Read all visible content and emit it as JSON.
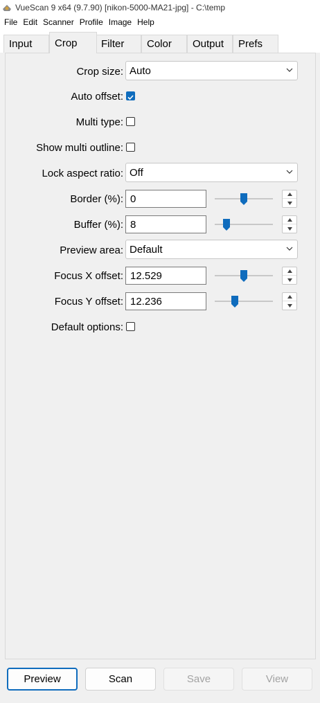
{
  "window": {
    "title": "VueScan 9 x64 (9.7.90) [nikon-5000-MA21-jpg] - C:\\temp"
  },
  "menu": {
    "items": [
      "File",
      "Edit",
      "Scanner",
      "Profile",
      "Image",
      "Help"
    ]
  },
  "tabs": [
    "Input",
    "Crop",
    "Filter",
    "Color",
    "Output",
    "Prefs"
  ],
  "active_tab": "Crop",
  "crop": {
    "crop_size": {
      "label": "Crop size:",
      "value": "Auto"
    },
    "auto_offset": {
      "label": "Auto offset:",
      "checked": true
    },
    "multi_type": {
      "label": "Multi type:",
      "checked": false
    },
    "show_multi_outline": {
      "label": "Show multi outline:",
      "checked": false
    },
    "lock_aspect_ratio": {
      "label": "Lock aspect ratio:",
      "value": "Off"
    },
    "border": {
      "label": "Border (%):",
      "value": "0",
      "slider_level": 0.5
    },
    "buffer": {
      "label": "Buffer (%):",
      "value": "8",
      "slider_level": 0.2
    },
    "preview_area": {
      "label": "Preview area:",
      "value": "Default"
    },
    "focus_x_offset": {
      "label": "Focus X offset:",
      "value": "12.529",
      "slider_level": 0.5
    },
    "focus_y_offset": {
      "label": "Focus Y offset:",
      "value": "12.236",
      "slider_level": 0.35
    },
    "default_options": {
      "label": "Default options:",
      "checked": false
    }
  },
  "buttons": {
    "preview": "Preview",
    "scan": "Scan",
    "save": "Save",
    "view": "View"
  },
  "colors": {
    "accent": "#0f6cbd",
    "disabled_text": "#a3a3a3"
  }
}
